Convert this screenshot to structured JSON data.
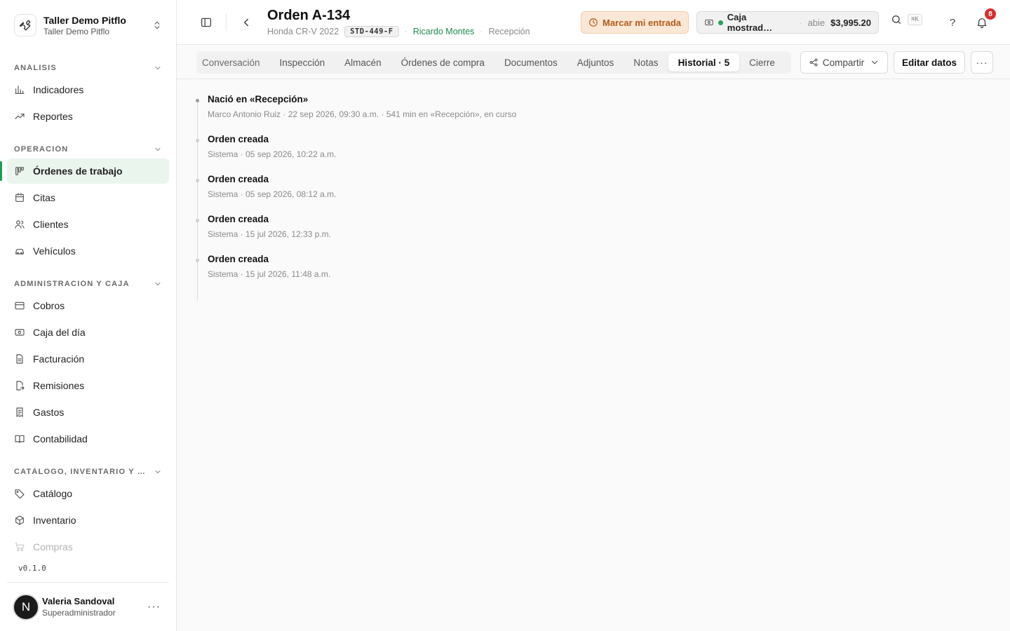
{
  "workspace": {
    "name": "Taller Demo Pitflo",
    "subtitle": "Taller Demo Pitflo"
  },
  "sidebar": {
    "sections": [
      {
        "title": "ANÁLISIS",
        "items": [
          {
            "label": "Indicadores",
            "icon": "bar-chart-icon"
          },
          {
            "label": "Reportes",
            "icon": "trend-icon"
          }
        ]
      },
      {
        "title": "OPERACIÓN",
        "items": [
          {
            "label": "Órdenes de trabajo",
            "icon": "kanban-icon",
            "active": true
          },
          {
            "label": "Citas",
            "icon": "calendar-icon"
          },
          {
            "label": "Clientes",
            "icon": "users-icon"
          },
          {
            "label": "Vehículos",
            "icon": "car-icon"
          }
        ]
      },
      {
        "title": "ADMINISTRACIÓN Y CAJA",
        "items": [
          {
            "label": "Cobros",
            "icon": "credit-card-icon"
          },
          {
            "label": "Caja del día",
            "icon": "cash-icon"
          },
          {
            "label": "Facturación",
            "icon": "file-icon"
          },
          {
            "label": "Remisiones",
            "icon": "file-export-icon"
          },
          {
            "label": "Gastos",
            "icon": "receipt-icon"
          },
          {
            "label": "Contabilidad",
            "icon": "book-icon"
          }
        ]
      },
      {
        "title": "CATÁLOGO, INVENTARIO Y CO…",
        "items": [
          {
            "label": "Catálogo",
            "icon": "tag-icon"
          },
          {
            "label": "Inventario",
            "icon": "box-icon"
          },
          {
            "label": "Compras",
            "icon": "cart-icon",
            "faded": true
          }
        ]
      }
    ],
    "version": "v0.1.0",
    "user": {
      "initial": "N",
      "name": "Valeria Sandoval",
      "role": "Superadministrador"
    }
  },
  "header": {
    "title": "Orden A-134",
    "vehicle": "Honda CR-V 2022",
    "plate": "STD-449-F",
    "client": "Ricardo Montes",
    "stage": "Recepción",
    "checkin_label": "Marcar mi entrada",
    "register": {
      "name": "Caja mostrad…",
      "state": "abie",
      "amount": "$3,995.20"
    },
    "search_shortcut": "⌘K",
    "notifications": "8",
    "help_label": "?"
  },
  "tabs": [
    {
      "label": "Conversación"
    },
    {
      "label": "Inspección"
    },
    {
      "label": "Almacén"
    },
    {
      "label": "Órdenes de compra"
    },
    {
      "label": "Documentos"
    },
    {
      "label": "Adjuntos"
    },
    {
      "label": "Notas"
    },
    {
      "label": "Historial · 5",
      "active": true
    },
    {
      "label": "Cierre"
    }
  ],
  "actions": {
    "share_label": "Compartir",
    "edit_label": "Editar datos"
  },
  "history": [
    {
      "title": "Nació en «Recepción»",
      "meta": "Marco Antonio Ruiz · 22 sep 2026, 09:30 a.m. · 541 min en «Recepción», en curso"
    },
    {
      "title": "Orden creada",
      "meta": "Sistema · 05 sep 2026, 10:22 a.m."
    },
    {
      "title": "Orden creada",
      "meta": "Sistema · 05 sep 2026, 08:12 a.m."
    },
    {
      "title": "Orden creada",
      "meta": "Sistema · 15 jul 2026, 12:33 p.m."
    },
    {
      "title": "Orden creada",
      "meta": "Sistema · 15 jul 2026, 11:48 a.m."
    }
  ],
  "colors": {
    "accent": "#1f9d55",
    "checkin_bg": "#fbe7d6",
    "checkin_text": "#b35a17",
    "badge": "#d92d2d"
  }
}
